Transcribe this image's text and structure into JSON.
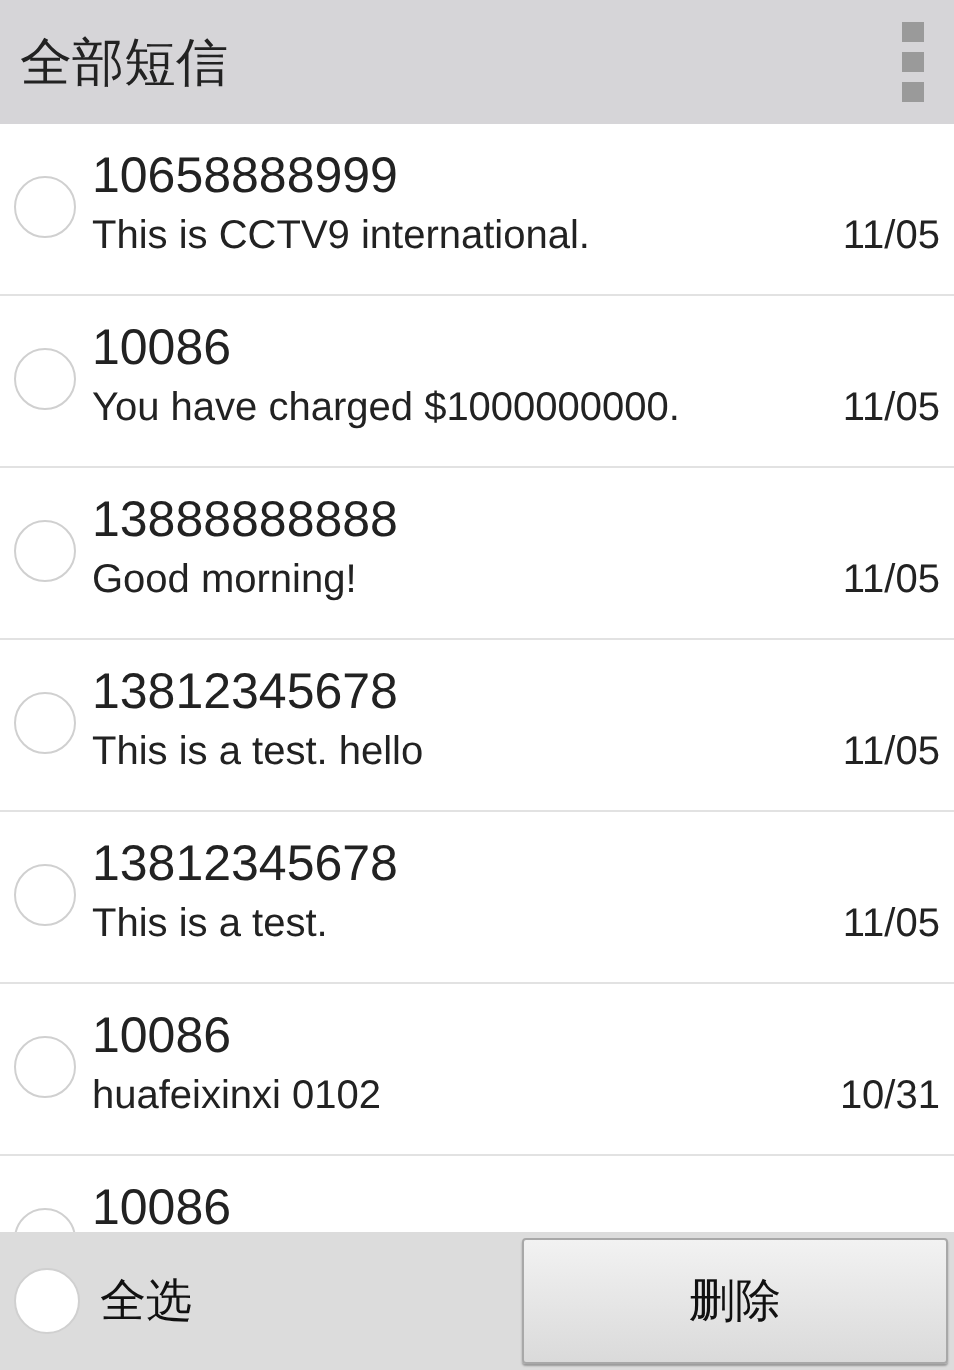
{
  "header": {
    "title": "全部短信"
  },
  "messages": [
    {
      "sender": "10658888999",
      "text": "This is CCTV9 international.",
      "date": "11/05",
      "selected": false
    },
    {
      "sender": "10086",
      "text": "You have charged $1000000000.",
      "date": "11/05",
      "selected": false
    },
    {
      "sender": "13888888888",
      "text": "Good morning!",
      "date": "11/05",
      "selected": false
    },
    {
      "sender": "13812345678",
      "text": "This is a test. hello",
      "date": "11/05",
      "selected": false
    },
    {
      "sender": "13812345678",
      "text": "This is a test.",
      "date": "11/05",
      "selected": false
    },
    {
      "sender": "10086",
      "text": "huafeixinxi 0102",
      "date": "10/31",
      "selected": false
    },
    {
      "sender": "10086",
      "selected": false
    }
  ],
  "bottom_bar": {
    "select_all": {
      "label": "全选",
      "checked": false
    },
    "delete_button": "删除"
  }
}
